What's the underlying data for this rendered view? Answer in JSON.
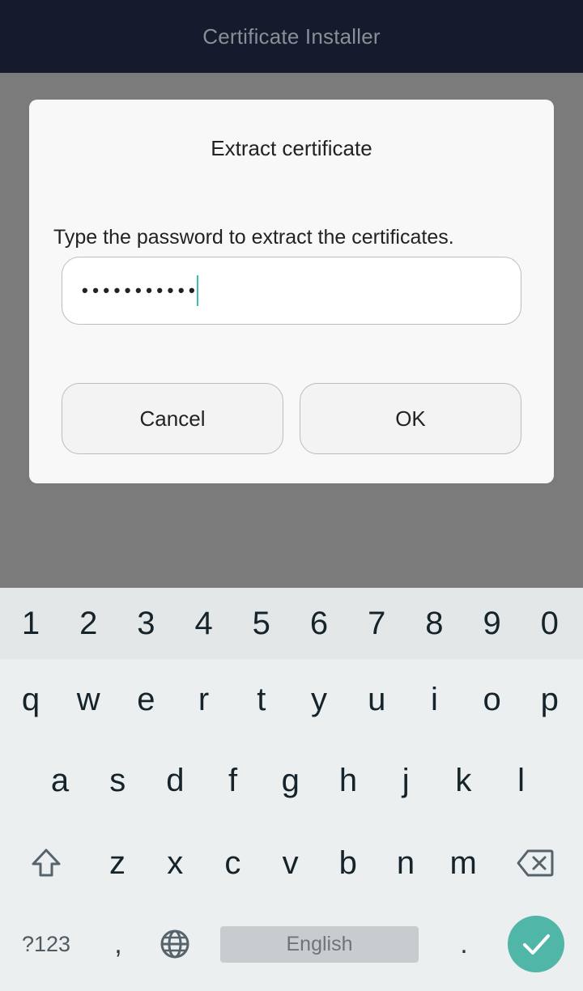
{
  "app": {
    "title": "Certificate Installer"
  },
  "dialog": {
    "title": "Extract certificate",
    "message": "Type the password to extract the certificates.",
    "password_masked": "•••••••••••",
    "password_length": 11,
    "cancel_label": "Cancel",
    "ok_label": "OK"
  },
  "keyboard": {
    "number_row": [
      "1",
      "2",
      "3",
      "4",
      "5",
      "6",
      "7",
      "8",
      "9",
      "0"
    ],
    "row1": [
      "q",
      "w",
      "e",
      "r",
      "t",
      "y",
      "u",
      "i",
      "o",
      "p"
    ],
    "row2": [
      "a",
      "s",
      "d",
      "f",
      "g",
      "h",
      "j",
      "k",
      "l"
    ],
    "row3": [
      "z",
      "x",
      "c",
      "v",
      "b",
      "n",
      "m"
    ],
    "symbols_label": "?123",
    "comma": ",",
    "space_label": "English",
    "period": ".",
    "shift_icon": "shift-icon",
    "backspace_icon": "backspace-icon",
    "language_icon": "globe-icon",
    "enter_icon": "check-icon"
  },
  "colors": {
    "accent": "#4fb6a8",
    "caret": "#3ebdb3",
    "appbar": "#161a2d"
  }
}
